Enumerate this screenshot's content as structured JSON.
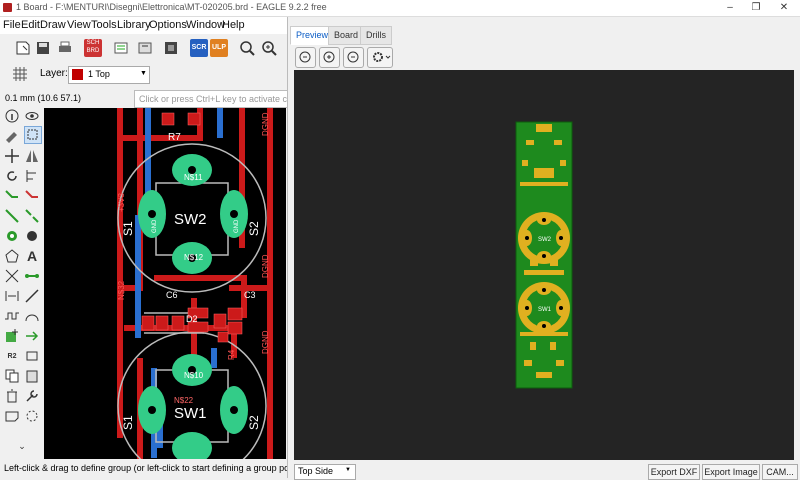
{
  "window": {
    "title": "1 Board - F:\\MENTURI\\Disegni\\Elettronica\\MT-020205.brd - EAGLE 9.2.2 free"
  },
  "menu": [
    "File",
    "Edit",
    "Draw",
    "View",
    "Tools",
    "Library",
    "Options",
    "Window",
    "Help"
  ],
  "toolbar": {
    "sch_label": "SCH",
    "brd_label": "BRD",
    "scr_label": "SCR",
    "ulp_label": "ULP"
  },
  "layerbar": {
    "label": "Layer:",
    "selected_layer": "1 Top",
    "layer_color": "#c00000"
  },
  "cmdbar": {
    "coords": "0.1 mm (10.6 57.1)",
    "placeholder": "Click or press Ctrl+L key to activate command line mode"
  },
  "tools": {
    "text_tool": "A",
    "r2_label": "R2"
  },
  "canvas": {
    "labels": {
      "r7": "R7",
      "n11": "N$11",
      "n12": "N$12",
      "sw2": "SW2",
      "sw1": "SW1",
      "s1_top": "S1",
      "s2_top": "S2",
      "dgnd": "DGND",
      "dgnd2": "DGND",
      "dgnd3": "DGND",
      "v3v3": "+3V3",
      "n32": "N$32",
      "n10": "N$10",
      "n22": "N$22",
      "c6": "C6",
      "c3": "C3",
      "d2": "D2",
      "r4": "R4",
      "s1_bot": "S1",
      "s2_bot": "S2",
      "gnd1": "GND",
      "gnd2": "GND"
    }
  },
  "statusbar": {
    "text": "Left-click & drag to define group (or left-click to start defining a group polygon)"
  },
  "panel": {
    "tabs": [
      "Preview",
      "Board",
      "Drills"
    ],
    "active_tab": "Preview",
    "side_select": "Top Side",
    "buttons": {
      "export_dxf": "Export DXF",
      "export_image": "Export Image",
      "cam": "CAM..."
    },
    "board_labels": {
      "sw2": "SW2",
      "sw1": "SW1"
    }
  },
  "colors": {
    "canvas_bg": "#000000",
    "preview_bg": "#242424",
    "board_green": "#1e8a1e",
    "pad_gold": "#e0b020",
    "trace_red": "#cc1a1a",
    "trace_blue": "#2a6fd0",
    "pad_green": "#33cc88"
  }
}
